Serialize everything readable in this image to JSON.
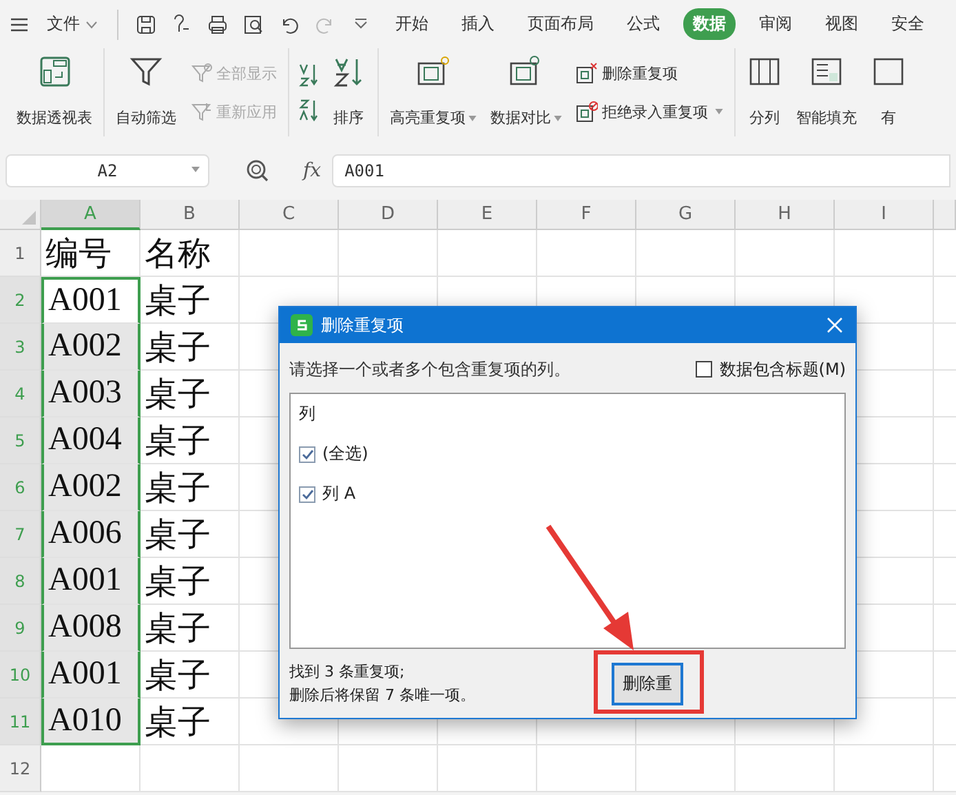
{
  "menu_bar": {
    "file_menu": "文件",
    "tabs": [
      {
        "label": "开始",
        "selected": false
      },
      {
        "label": "插入",
        "selected": false
      },
      {
        "label": "页面布局",
        "selected": false
      },
      {
        "label": "公式",
        "selected": false
      },
      {
        "label": "数据",
        "selected": true
      },
      {
        "label": "审阅",
        "selected": false
      },
      {
        "label": "视图",
        "selected": false
      },
      {
        "label": "安全",
        "selected": false
      }
    ]
  },
  "ribbon": {
    "groups": [
      {
        "items": [
          {
            "kind": "big",
            "label": "数据透视表",
            "disabled": false,
            "dropdown": false
          }
        ]
      },
      {
        "items": [
          {
            "kind": "big",
            "label": "自动筛选",
            "disabled": false,
            "dropdown": false
          },
          {
            "kind": "stack",
            "entries": [
              {
                "label": "全部显示",
                "disabled": true,
                "dropdown": false
              },
              {
                "label": "重新应用",
                "disabled": true,
                "dropdown": false
              }
            ]
          }
        ]
      },
      {
        "items": [
          {
            "kind": "icons"
          },
          {
            "kind": "big",
            "label": "排序",
            "disabled": false,
            "dropdown": false
          }
        ]
      },
      {
        "items": [
          {
            "kind": "big",
            "label": "高亮重复项",
            "disabled": false,
            "dropdown": true
          },
          {
            "kind": "big",
            "label": "数据对比",
            "disabled": false,
            "dropdown": true
          },
          {
            "kind": "stack",
            "entries": [
              {
                "label": "删除重复项",
                "disabled": false,
                "dropdown": false
              },
              {
                "label": "拒绝录入重复项",
                "disabled": false,
                "dropdown": true
              }
            ]
          }
        ]
      },
      {
        "items": [
          {
            "kind": "big",
            "label": "分列",
            "disabled": false,
            "dropdown": false
          },
          {
            "kind": "big",
            "label": "智能填充",
            "disabled": false,
            "dropdown": false
          },
          {
            "kind": "big",
            "label": "有",
            "disabled": false,
            "dropdown": false
          }
        ]
      }
    ]
  },
  "formula_bar": {
    "name_box": "A2",
    "function_label": "fx",
    "formula": "A001"
  },
  "sheet": {
    "columns": [
      {
        "label": "A",
        "selected": true
      },
      {
        "label": "B",
        "selected": false
      },
      {
        "label": "C",
        "selected": false
      },
      {
        "label": "D",
        "selected": false
      },
      {
        "label": "E",
        "selected": false
      },
      {
        "label": "F",
        "selected": false
      },
      {
        "label": "G",
        "selected": false
      },
      {
        "label": "H",
        "selected": false
      },
      {
        "label": "I",
        "selected": false
      }
    ],
    "rows": [
      {
        "number": "1",
        "cells": [
          "编号",
          "名称"
        ],
        "selected": false
      },
      {
        "number": "2",
        "cells": [
          "A001",
          "桌子"
        ],
        "selected": true
      },
      {
        "number": "3",
        "cells": [
          "A002",
          "桌子"
        ],
        "selected": true
      },
      {
        "number": "4",
        "cells": [
          "A003",
          "桌子"
        ],
        "selected": true
      },
      {
        "number": "5",
        "cells": [
          "A004",
          "桌子"
        ],
        "selected": true
      },
      {
        "number": "6",
        "cells": [
          "A002",
          "桌子"
        ],
        "selected": true
      },
      {
        "number": "7",
        "cells": [
          "A006",
          "桌子"
        ],
        "selected": true
      },
      {
        "number": "8",
        "cells": [
          "A001",
          "桌子"
        ],
        "selected": true
      },
      {
        "number": "9",
        "cells": [
          "A008",
          "桌子"
        ],
        "selected": true
      },
      {
        "number": "10",
        "cells": [
          "A001",
          "桌子"
        ],
        "selected": true
      },
      {
        "number": "11",
        "cells": [
          "A010",
          "桌子"
        ],
        "selected": true
      },
      {
        "number": "12",
        "cells": [],
        "selected": false
      }
    ]
  },
  "dialog": {
    "title": "删除重复项",
    "prompt": "请选择一个或者多个包含重复项的列。",
    "header_option": {
      "label": "数据包含标题(M)",
      "checked": false
    },
    "list_header": "列",
    "options": [
      {
        "label": "(全选)",
        "checked": true
      },
      {
        "label": "列 A",
        "checked": true
      }
    ],
    "summary": [
      "找到 3 条重复项;",
      "删除后将保留 7 条唯一项。"
    ],
    "button": "删除重"
  }
}
